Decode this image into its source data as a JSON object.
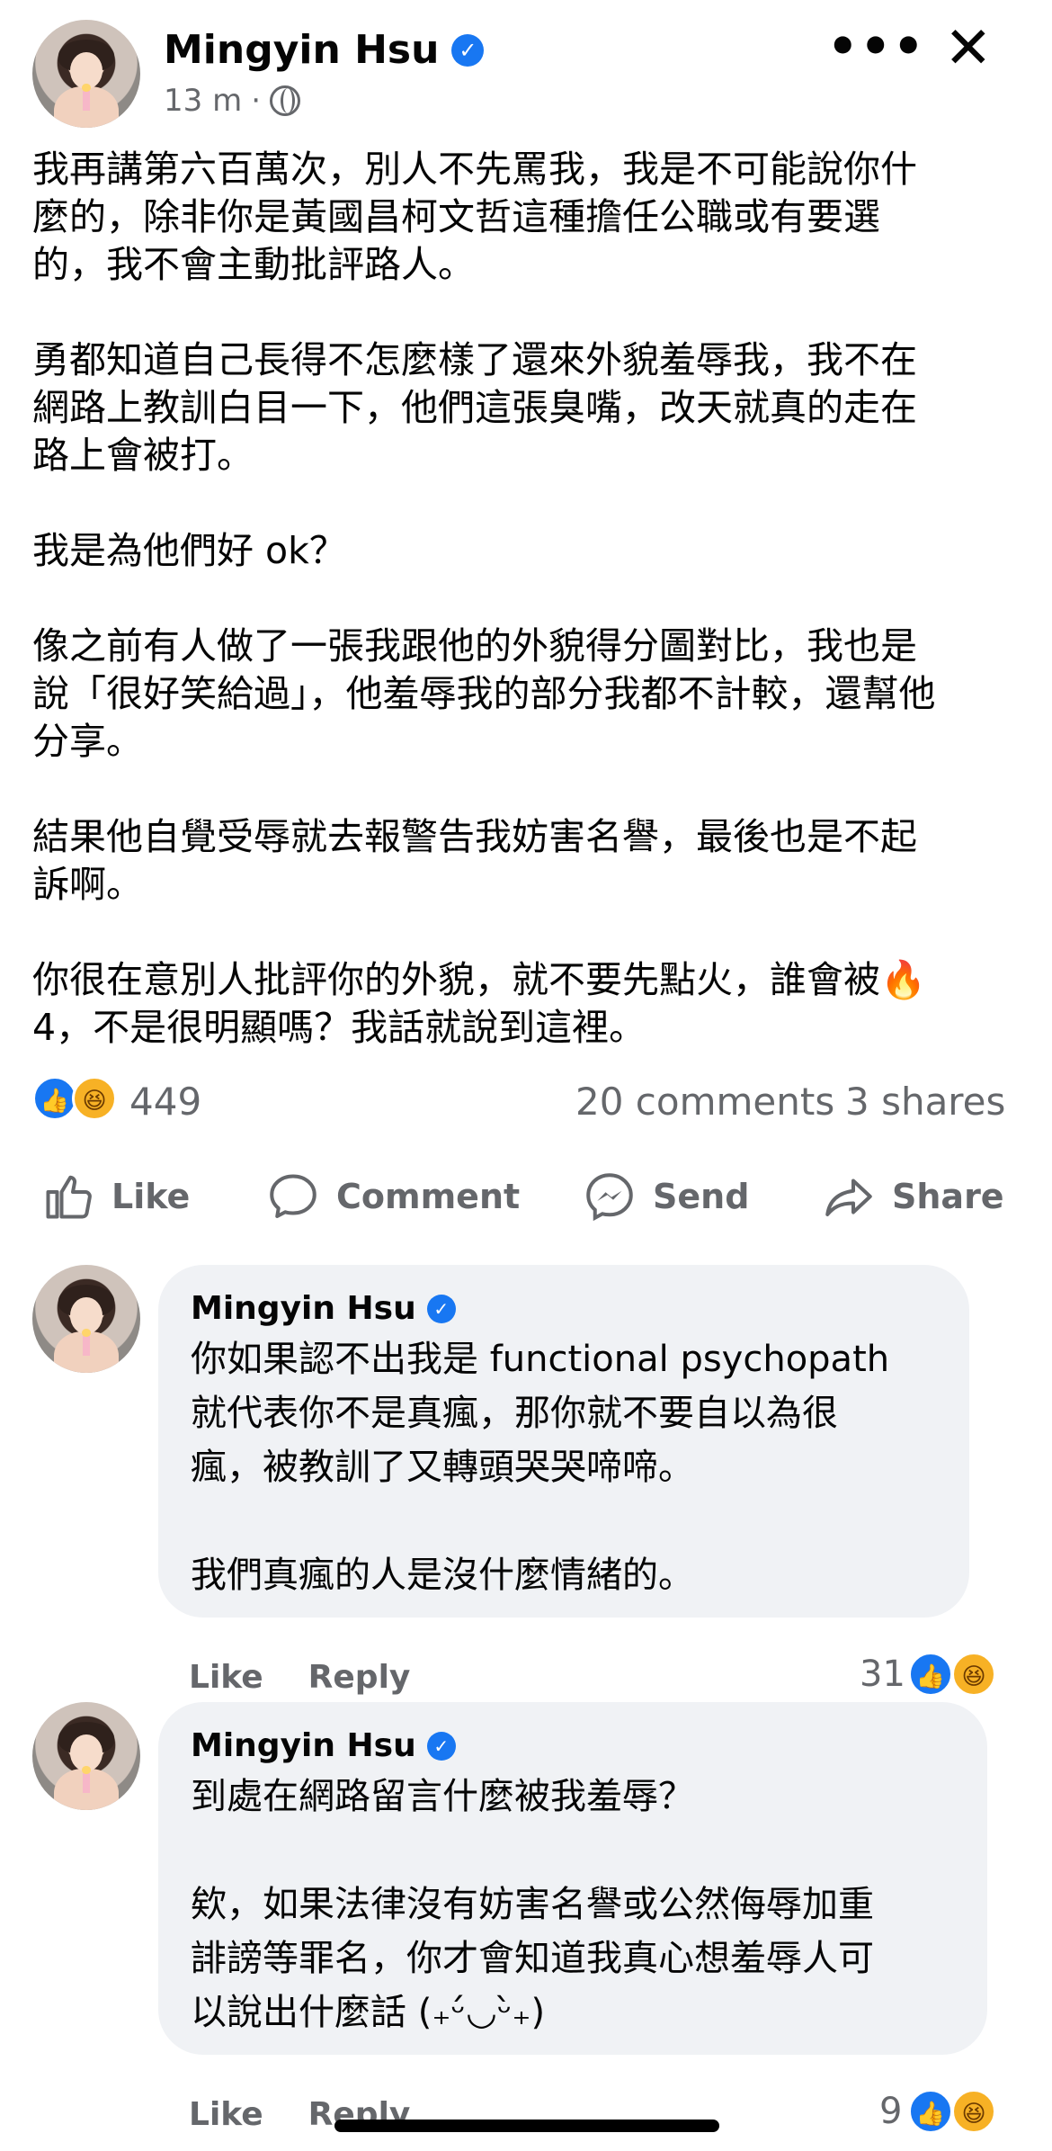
{
  "post": {
    "author": "Mingyin Hsu",
    "time": "13 m",
    "dot": "·",
    "body": "我再講第六百萬次，別人不先罵我，我是不可能說你什\n麼的，除非你是黃國昌柯文哲這種擔任公職或有要選\n的，我不會主動批評路人。\n\n勇都知道自己長得不怎麼樣了還來外貌羞辱我，我不在\n網路上教訓白目一下，他們這張臭嘴，改天就真的走在\n路上會被打。\n\n我是為他們好 ok？\n\n像之前有人做了一張我跟他的外貌得分圖對比，我也是\n說「很好笑給過」，他羞辱我的部分我都不計較，還幫他\n分享。\n\n結果他自覺受辱就去報警告我妨害名譽，最後也是不起\n訴啊。\n\n你很在意別人批評你的外貌，就不要先點火，誰會被🔥\n4，不是很明顯嗎？我話就說到這裡。",
    "reaction_count": "449",
    "comments_count": "20 comments",
    "shares_count": "3 shares"
  },
  "actions": {
    "like": "Like",
    "comment": "Comment",
    "send": "Send",
    "share": "Share"
  },
  "comments": [
    {
      "author": "Mingyin Hsu",
      "text": "你如果認不出我是 functional psychopath\n就代表你不是真瘋，那你就不要自以為很\n瘋，被教訓了又轉頭哭哭啼啼。\n\n我們真瘋的人是沒什麼情緒的。",
      "like_label": "Like",
      "reply_label": "Reply",
      "reaction_count": "31"
    },
    {
      "author": "Mingyin Hsu",
      "text": "到處在網路留言什麼被我羞辱？\n\n欸，如果法律沒有妨害名譽或公然侮辱加重\n誹謗等罪名，你才會知道我真心想羞辱人可\n以說出什麼話 (₊ᵕ́◡ᵕ̀₊)",
      "like_label": "Like",
      "reply_label": "Reply",
      "reaction_count": "9"
    }
  ],
  "icons": {
    "verified": "verified-badge-icon",
    "more": "more-options-icon",
    "close": "close-icon",
    "privacy": "globe-icon",
    "like_reaction": "like-reaction-icon",
    "haha_reaction": "haha-reaction-icon"
  },
  "colors": {
    "accent": "#1877f2",
    "secondary_text": "#65676b",
    "bubble": "#f0f2f5"
  }
}
